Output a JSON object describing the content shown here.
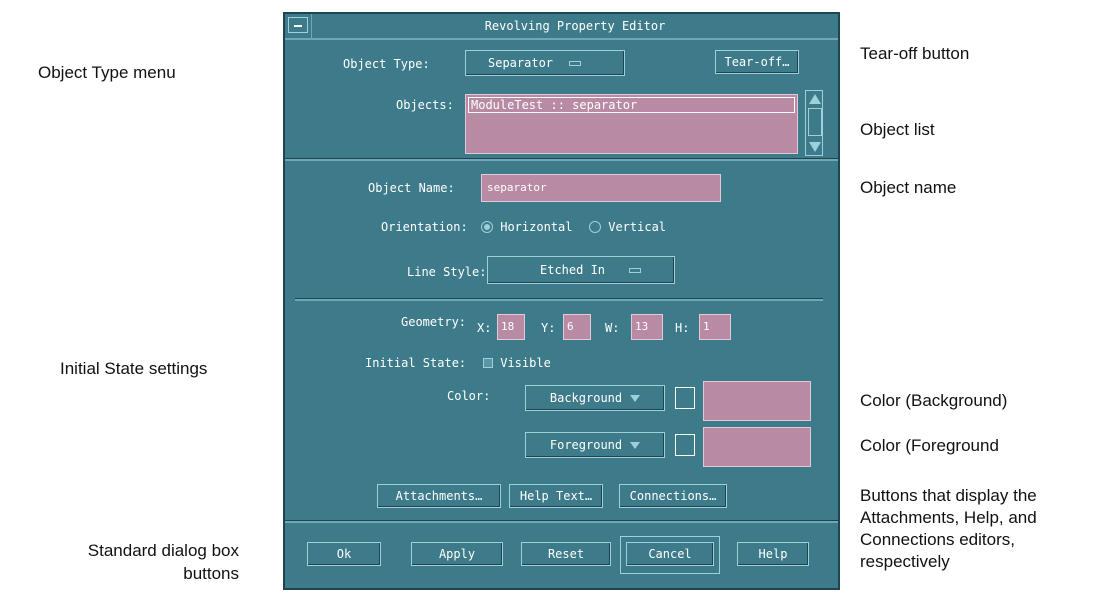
{
  "callouts": {
    "object_type_menu": "Object Type menu",
    "initial_state": "Initial State settings",
    "standard_buttons_line1": "Standard dialog  box",
    "standard_buttons_line2": "buttons",
    "tearoff_button": "Tear-off button",
    "object_list": "Object list",
    "object_name": "Object name",
    "color_background": "Color (Background)",
    "color_foreground": "Color (Foreground",
    "editors_line1": "Buttons that display the",
    "editors_line2": "Attachments, Help, and",
    "editors_line3": "Connections editors,",
    "editors_line4": "respectively"
  },
  "window": {
    "title": "Revolving Property Editor"
  },
  "object_type": {
    "label": "Object Type:",
    "value": "Separator"
  },
  "tearoff": {
    "label": "Tear-off…"
  },
  "objects": {
    "label": "Objects:",
    "items": [
      "ModuleTest :: separator"
    ]
  },
  "object_name": {
    "label": "Object Name:",
    "value": "separator"
  },
  "orientation": {
    "label": "Orientation:",
    "horizontal": "Horizontal",
    "vertical": "Vertical",
    "selected": "Horizontal"
  },
  "line_style": {
    "label": "Line Style:",
    "value": "Etched In"
  },
  "geometry": {
    "label": "Geometry:",
    "x_label": "X:",
    "x": "18",
    "y_label": "Y:",
    "y": "6",
    "w_label": "W:",
    "w": "13",
    "h_label": "H:",
    "h": "1"
  },
  "initial_state": {
    "label": "Initial State:",
    "visible_label": "Visible"
  },
  "color": {
    "label": "Color:",
    "background_label": "Background",
    "foreground_label": "Foreground",
    "background_value": "",
    "foreground_value": ""
  },
  "editor_buttons": {
    "attachments": "Attachments…",
    "help_text": "Help Text…",
    "connections": "Connections…"
  },
  "footer": {
    "ok": "Ok",
    "apply": "Apply",
    "reset": "Reset",
    "cancel": "Cancel",
    "help": "Help"
  },
  "colors": {
    "dialog_bg": "#3d7b8a",
    "field_bg": "#b88aa3"
  }
}
